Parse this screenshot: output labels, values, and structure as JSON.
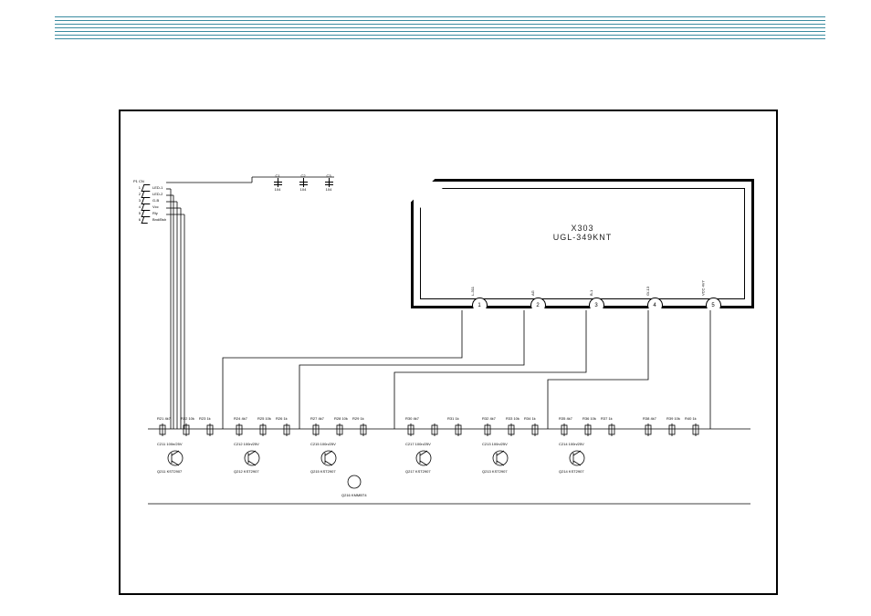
{
  "connector": {
    "header": "P1 CN",
    "pins": [
      {
        "num": "1",
        "net": "LED-1"
      },
      {
        "num": "2",
        "net": "LED-2"
      },
      {
        "num": "3",
        "net": "G-B"
      },
      {
        "num": "4",
        "net": "Vcc"
      },
      {
        "num": "5",
        "net": "Rly"
      },
      {
        "num": "6",
        "net": "Bnd/Bsh"
      }
    ]
  },
  "top_caps": [
    {
      "ref": "C1",
      "val": "104"
    },
    {
      "ref": "C2",
      "val": "104"
    },
    {
      "ref": "C3",
      "val": "104"
    }
  ],
  "module": {
    "ref": "X303",
    "part": "UGL-349KNT",
    "pins": [
      {
        "n": "1",
        "net": "L-311"
      },
      {
        "n": "2",
        "net": "AG"
      },
      {
        "n": "3",
        "net": "B-1"
      },
      {
        "n": "4",
        "net": "G/-13"
      },
      {
        "n": "5",
        "net": "VCC 4V7"
      }
    ]
  },
  "stages": [
    {
      "pos": 28,
      "labels": {
        "rtop1": "R21 4k7",
        "rtop2": "R22 10k",
        "cap": "C211 100n/25V",
        "q": "Q211 KST2907",
        "rbot": "R23 1k"
      }
    },
    {
      "pos": 112,
      "labels": {
        "rtop1": "R24 4k7",
        "rtop2": "R25 10k",
        "cap": "C212 100n/25V",
        "q": "Q212 KST2907",
        "rbot": "R26 1k"
      }
    },
    {
      "pos": 196,
      "labels": {
        "rtop1": "R27 4k7",
        "rtop2": "R28 10k",
        "cap": "C215 100n/25V",
        "q": "Q215 KST2907",
        "rbot": "R29 1k",
        "qextra": "Q216 KMMBT4"
      }
    },
    {
      "pos": 300,
      "labels": {
        "rtop1": "R30 4k7",
        "rtop2": "",
        "cap": "C217 100n/25V",
        "q": "Q217 KST2907",
        "rbot": "R31 1k"
      }
    },
    {
      "pos": 384,
      "labels": {
        "rtop1": "R32 4k7",
        "rtop2": "R33 10k",
        "cap": "C213 100n/25V",
        "q": "Q213 KST2907",
        "rbot": "R34 1k"
      }
    },
    {
      "pos": 468,
      "labels": {
        "rtop1": "R35 4k7",
        "rtop2": "R36 10k",
        "cap": "C214 100n/25V",
        "q": "Q214 KST2907",
        "rbot": "R37 1k"
      }
    },
    {
      "pos": 560,
      "labels": {
        "rtop1": "R38 4k7",
        "rtop2": "R39 10k",
        "cap": "",
        "q": "",
        "rbot": "R40 1k"
      }
    }
  ]
}
